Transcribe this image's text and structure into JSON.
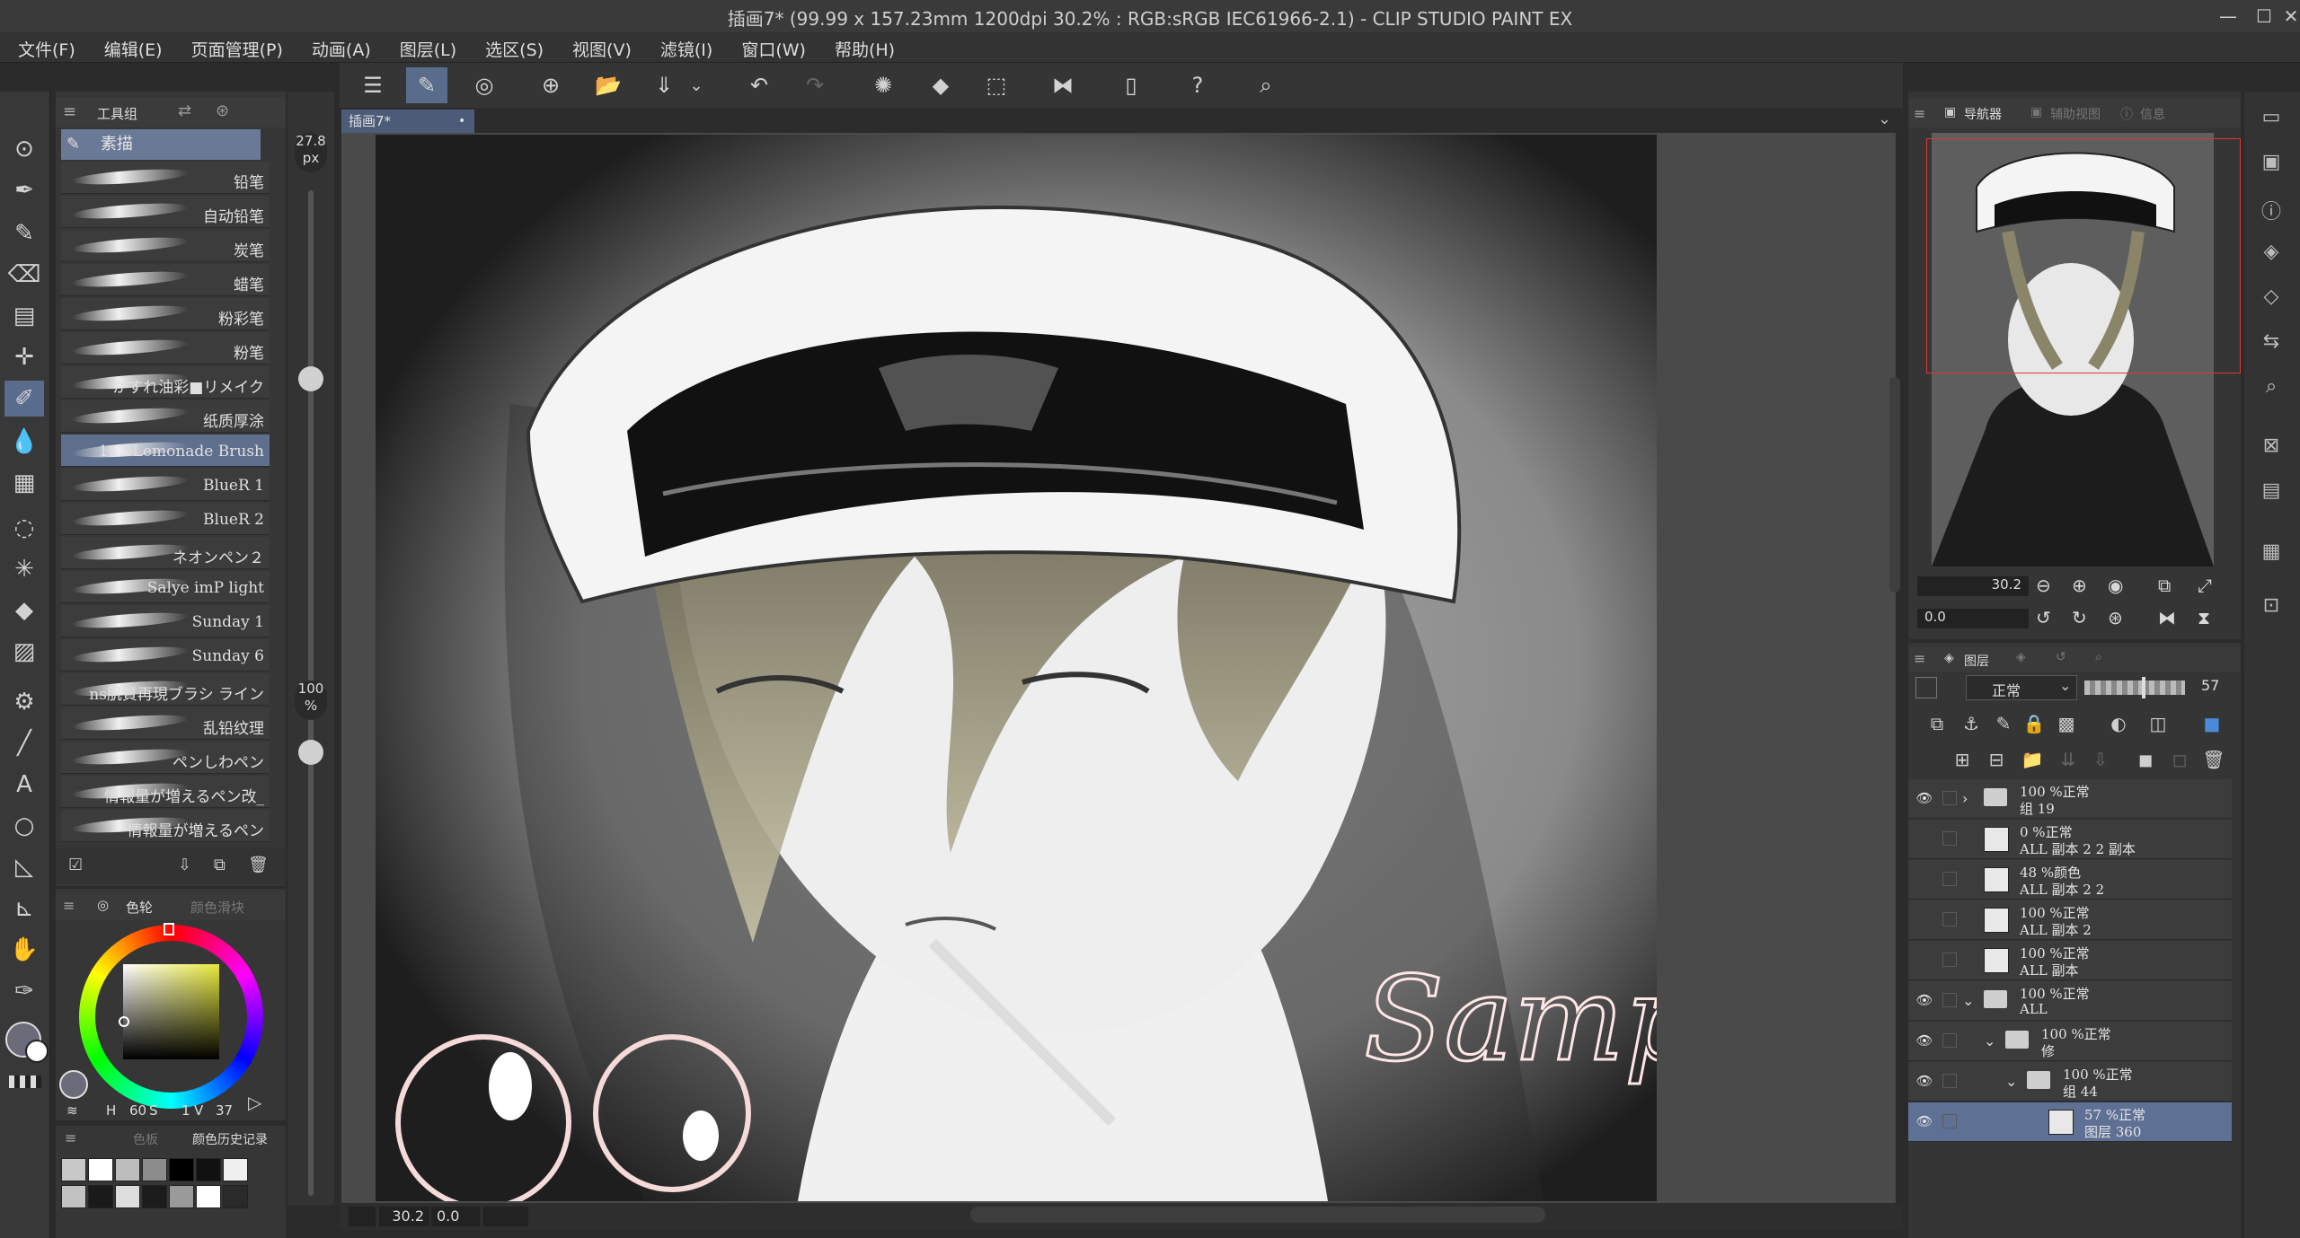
{
  "window": {
    "title": "插画7* (99.99 x 157.23mm 1200dpi 30.2% : RGB:sRGB IEC61966-2.1) - CLIP STUDIO PAINT EX",
    "minimize": "—",
    "maximize": "☐",
    "close": "✕"
  },
  "menu": [
    "文件(F)",
    "编辑(E)",
    "页面管理(P)",
    "动画(A)",
    "图层(L)",
    "选区(S)",
    "视图(V)",
    "滤镜(I)",
    "窗口(W)",
    "帮助(H)"
  ],
  "subtool": {
    "tab_label": "工具组",
    "group_label": "素描",
    "brushes": [
      {
        "name": "铅笔"
      },
      {
        "name": "自动铅笔"
      },
      {
        "name": "炭笔"
      },
      {
        "name": "蜡笔"
      },
      {
        "name": "粉彩笔"
      },
      {
        "name": "粉笔"
      },
      {
        "name": "かすれ油彩■リメイク"
      },
      {
        "name": "纸质厚涂"
      },
      {
        "name": "112 Lemonade Brush"
      },
      {
        "name": "BlueR 1"
      },
      {
        "name": "BlueR 2"
      },
      {
        "name": "ネオンペン２"
      },
      {
        "name": "Salye imP light"
      },
      {
        "name": "Sunday 1"
      },
      {
        "name": "Sunday 6"
      },
      {
        "name": "ns肌質再現ブラシ ライン"
      },
      {
        "name": "乱铅纹理"
      },
      {
        "name": "ペンしわペン"
      },
      {
        "name": "情報量が増えるペン改_"
      },
      {
        "name": "情報量が増えるペン"
      }
    ],
    "active_index": 8
  },
  "brush_size": {
    "value": "27.8",
    "unit": "px",
    "level": 0.66
  },
  "brush_opacity": {
    "value": "100",
    "unit": "%",
    "level": 1.0
  },
  "color": {
    "tab1": "色轮",
    "tab2": "颜色滑块",
    "hue_color": "#e8e83a",
    "info_a": "60",
    "info_a_label": "S",
    "info_b": "1",
    "info_b_label": "V",
    "info_c": "37",
    "history_tab1": "色板",
    "history_tab2": "颜色历史记录",
    "swatches": [
      "#c8c8c8",
      "#ffffff",
      "#bdbdbd",
      "#8c8c8c",
      "#000000",
      "#111111",
      "#f0f0f0",
      "#c2c2c2",
      "#1a1a1a",
      "#dddddd",
      "#1c1c1c",
      "#9a9a9a",
      "#ffffff",
      "#2a2a2a"
    ]
  },
  "document": {
    "tab_label": "插画7*",
    "zoom": "30.2",
    "angle": "0.0",
    "signature": "Sample"
  },
  "navigator": {
    "tab1": "导航器",
    "tab2": "辅助视图",
    "tab3": "信息",
    "zoom": "30.2",
    "rotation": "0.0"
  },
  "layers": {
    "tab_label": "图层",
    "blend_mode": "正常",
    "opacity": "57",
    "rows": [
      {
        "line1": "100 %正常",
        "line2": "组 19",
        "kind": "folder",
        "visible": true,
        "indent": 0,
        "twisty": ">"
      },
      {
        "line1": "0 %正常",
        "line2": "ALL 副本 2 2 副本",
        "kind": "layer",
        "visible": false,
        "indent": 0,
        "twisty": ""
      },
      {
        "line1": "48 %颜色",
        "line2": "ALL 副本 2 2",
        "kind": "layer",
        "visible": false,
        "indent": 0,
        "twisty": ""
      },
      {
        "line1": "100 %正常",
        "line2": "ALL 副本 2",
        "kind": "layer",
        "visible": false,
        "indent": 0,
        "twisty": ""
      },
      {
        "line1": "100 %正常",
        "line2": "ALL 副本",
        "kind": "layer",
        "visible": false,
        "indent": 0,
        "twisty": ""
      },
      {
        "line1": "100 %正常",
        "line2": "ALL",
        "kind": "folder",
        "visible": true,
        "indent": 0,
        "twisty": "v"
      },
      {
        "line1": "100 %正常",
        "line2": "修",
        "kind": "folder",
        "visible": true,
        "indent": 1,
        "twisty": "v"
      },
      {
        "line1": "100 %正常",
        "line2": "组 44",
        "kind": "folder",
        "visible": true,
        "indent": 2,
        "twisty": "v"
      },
      {
        "line1": "57 %正常",
        "line2": "图层 360",
        "kind": "layer",
        "visible": true,
        "indent": 3,
        "twisty": "",
        "selected": true
      }
    ]
  }
}
